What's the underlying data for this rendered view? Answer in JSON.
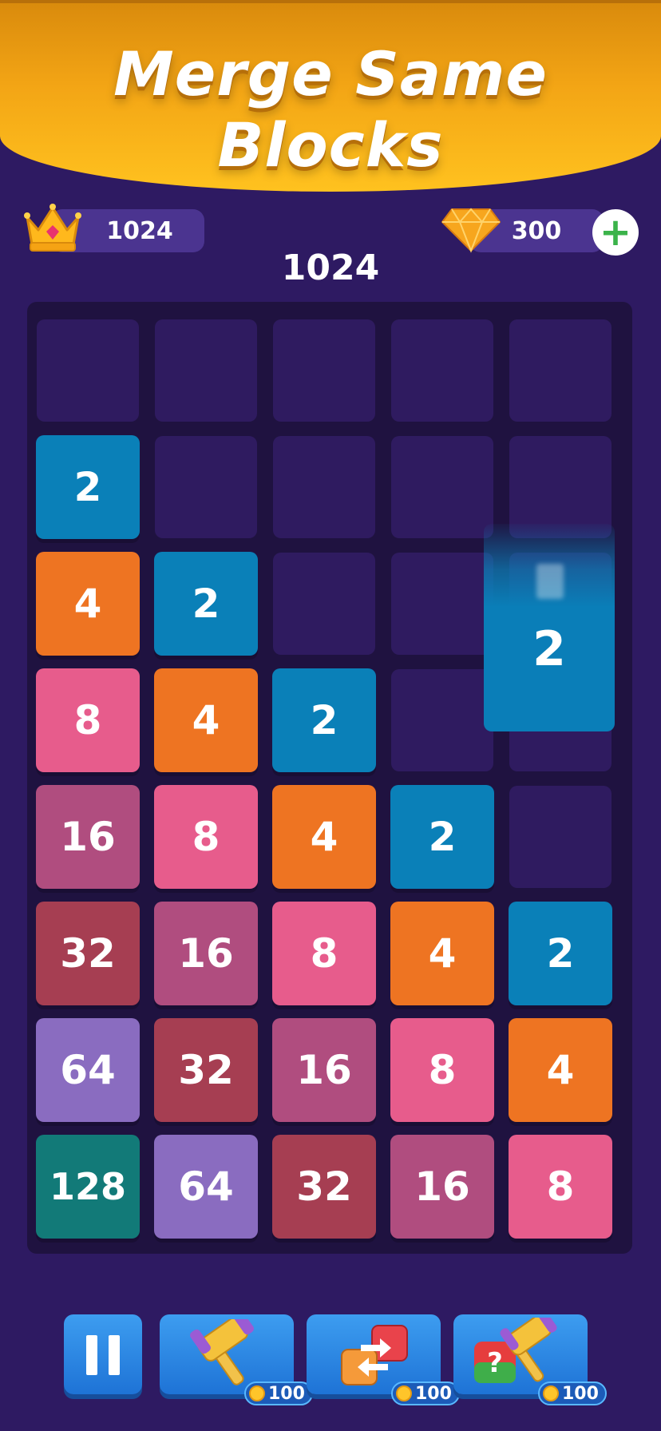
{
  "header": {
    "title": "Merge Same Blocks"
  },
  "stats": {
    "best_score": "1024",
    "gems": "300",
    "current_score": "1024"
  },
  "board": {
    "columns": 5,
    "rows": 8,
    "tiles": [
      {
        "row": 1,
        "col": 0,
        "value": "2"
      },
      {
        "row": 2,
        "col": 0,
        "value": "4"
      },
      {
        "row": 2,
        "col": 1,
        "value": "2"
      },
      {
        "row": 3,
        "col": 0,
        "value": "8"
      },
      {
        "row": 3,
        "col": 1,
        "value": "4"
      },
      {
        "row": 3,
        "col": 2,
        "value": "2"
      },
      {
        "row": 4,
        "col": 0,
        "value": "16"
      },
      {
        "row": 4,
        "col": 1,
        "value": "8"
      },
      {
        "row": 4,
        "col": 2,
        "value": "4"
      },
      {
        "row": 4,
        "col": 3,
        "value": "2"
      },
      {
        "row": 5,
        "col": 0,
        "value": "32"
      },
      {
        "row": 5,
        "col": 1,
        "value": "16"
      },
      {
        "row": 5,
        "col": 2,
        "value": "8"
      },
      {
        "row": 5,
        "col": 3,
        "value": "4"
      },
      {
        "row": 5,
        "col": 4,
        "value": "2"
      },
      {
        "row": 6,
        "col": 0,
        "value": "64"
      },
      {
        "row": 6,
        "col": 1,
        "value": "32"
      },
      {
        "row": 6,
        "col": 2,
        "value": "16"
      },
      {
        "row": 6,
        "col": 3,
        "value": "8"
      },
      {
        "row": 6,
        "col": 4,
        "value": "4"
      },
      {
        "row": 7,
        "col": 0,
        "value": "128"
      },
      {
        "row": 7,
        "col": 1,
        "value": "64"
      },
      {
        "row": 7,
        "col": 2,
        "value": "32"
      },
      {
        "row": 7,
        "col": 3,
        "value": "16"
      },
      {
        "row": 7,
        "col": 4,
        "value": "8"
      }
    ],
    "falling_block": {
      "col": 4,
      "value": "2"
    }
  },
  "tile_colors": {
    "2": "#0a80b8",
    "4": "#ee7422",
    "8": "#e75c8c",
    "16": "#b04d7f",
    "32": "#a63e52",
    "64": "#8a6cc0",
    "128": "#127a78"
  },
  "powerups": [
    {
      "name": "pause",
      "icon": "pause-icon"
    },
    {
      "name": "hammer",
      "icon": "hammer-icon",
      "cost": "100"
    },
    {
      "name": "swap",
      "icon": "swap-icon",
      "cost": "100"
    },
    {
      "name": "random-hammer",
      "icon": "question-hammer-icon",
      "cost": "100"
    }
  ]
}
